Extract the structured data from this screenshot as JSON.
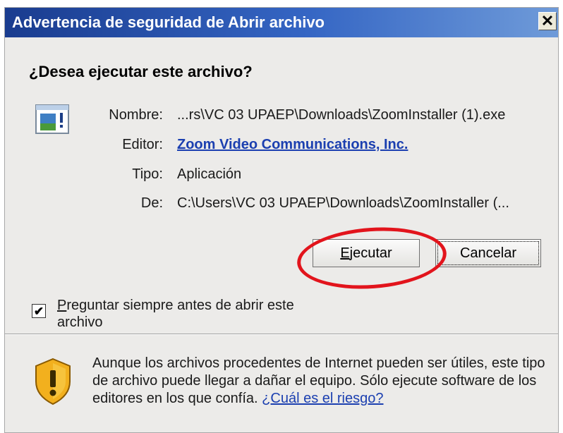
{
  "window": {
    "title": "Advertencia de seguridad de Abrir archivo",
    "close_glyph": "✕"
  },
  "prompt": {
    "question": "¿Desea ejecutar este archivo?"
  },
  "file_info": {
    "icon": "executable-file-icon",
    "name_label": "Nombre:",
    "name_value": "...rs\\VC 03 UPAEP\\Downloads\\ZoomInstaller (1).exe",
    "publisher_label": "Editor:",
    "publisher_value": "Zoom Video Communications, Inc.",
    "type_label": "Tipo:",
    "type_value": "Aplicación",
    "from_label": "De:",
    "from_value": "C:\\Users\\VC 03 UPAEP\\Downloads\\ZoomInstaller (..."
  },
  "buttons": {
    "run_mnemonic": "E",
    "run_rest": "jecutar",
    "cancel_label": "Cancelar"
  },
  "checkbox": {
    "checked": true,
    "check_glyph": "✔",
    "label_mnemonic": "P",
    "label_rest": "reguntar siempre antes de abrir este archivo"
  },
  "warning": {
    "icon": "shield-warning-icon",
    "text": "Aunque los archivos procedentes de Internet pueden ser útiles, este tipo de archivo puede llegar a dañar el equipo. Sólo ejecute software de los editores en los que confía.",
    "link": "¿Cuál es el riesgo?"
  },
  "colors": {
    "titlebar_start": "#1a3c8f",
    "titlebar_end": "#6f9bd9",
    "link": "#1b3fb0",
    "highlight": "#e2141c"
  }
}
